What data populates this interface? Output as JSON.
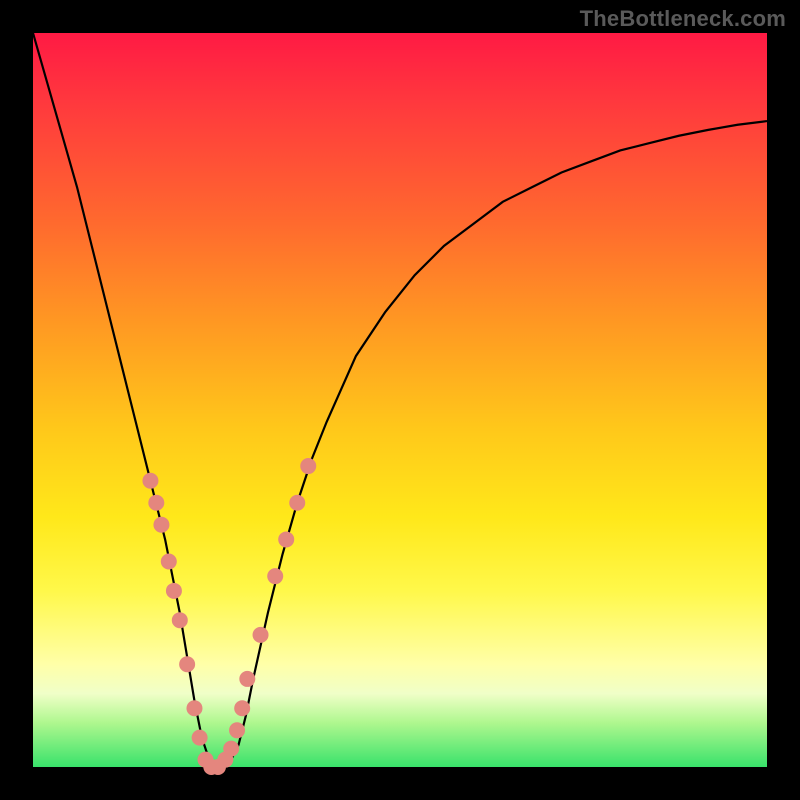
{
  "watermark": "TheBottleneck.com",
  "chart_data": {
    "type": "line",
    "title": "",
    "xlabel": "",
    "ylabel": "",
    "xlim": [
      0,
      100
    ],
    "ylim": [
      0,
      100
    ],
    "series": [
      {
        "name": "bottleneck-curve",
        "x": [
          0,
          2,
          4,
          6,
          8,
          10,
          12,
          14,
          16,
          17,
          18,
          19,
          20,
          21,
          22,
          23,
          24,
          25,
          26,
          27,
          28,
          29,
          30,
          32,
          34,
          36,
          38,
          40,
          44,
          48,
          52,
          56,
          60,
          64,
          68,
          72,
          76,
          80,
          84,
          88,
          92,
          96,
          100
        ],
        "values": [
          100,
          93,
          86,
          79,
          71,
          63,
          55,
          47,
          39,
          35,
          31,
          26,
          21,
          15,
          9,
          4,
          1,
          0,
          0,
          1,
          3,
          7,
          12,
          21,
          29,
          36,
          42,
          47,
          56,
          62,
          67,
          71,
          74,
          77,
          79,
          81,
          82.5,
          84,
          85,
          86,
          86.8,
          87.5,
          88
        ]
      }
    ],
    "markers": {
      "name": "highlight-dots",
      "color": "#e4867e",
      "radius_px": 8,
      "points_xy": [
        [
          16,
          39
        ],
        [
          16.8,
          36
        ],
        [
          17.5,
          33
        ],
        [
          18.5,
          28
        ],
        [
          19.2,
          24
        ],
        [
          20,
          20
        ],
        [
          21,
          14
        ],
        [
          22,
          8
        ],
        [
          22.7,
          4
        ],
        [
          23.5,
          1
        ],
        [
          24.3,
          0
        ],
        [
          25.2,
          0
        ],
        [
          26.2,
          1
        ],
        [
          27,
          2.5
        ],
        [
          27.8,
          5
        ],
        [
          28.5,
          8
        ],
        [
          29.2,
          12
        ],
        [
          31,
          18
        ],
        [
          33,
          26
        ],
        [
          34.5,
          31
        ],
        [
          36,
          36
        ],
        [
          37.5,
          41
        ]
      ]
    }
  }
}
